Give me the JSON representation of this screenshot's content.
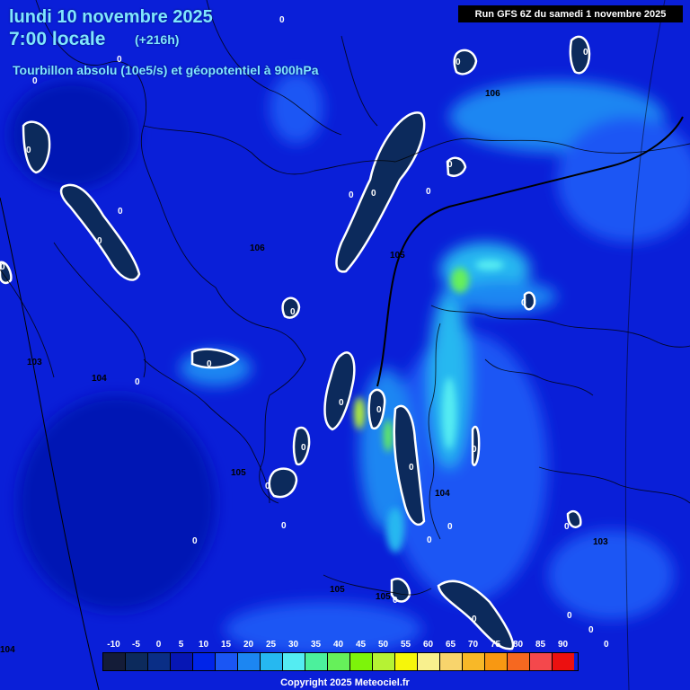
{
  "header": {
    "date": "lundi 10 novembre 2025",
    "time": "7:00 locale",
    "offset": "(+216h)",
    "parameter": "Tourbillon absolu (10e5/s) et géopotentiel à 900hPa",
    "run": "Run GFS 6Z du samedi 1 novembre 2025"
  },
  "map": {
    "geopotential_labels": [
      "106",
      "106",
      "105",
      "103",
      "104",
      "105",
      "104",
      "103",
      "105",
      "105",
      "104"
    ],
    "vorticity_zero_label": "0"
  },
  "legend": {
    "labels": [
      "-10",
      "-5",
      "0",
      "5",
      "10",
      "15",
      "20",
      "25",
      "30",
      "35",
      "40",
      "45",
      "50",
      "55",
      "60",
      "65",
      "70",
      "75",
      "80",
      "85",
      "90"
    ],
    "colors": [
      "#141c38",
      "#0c2a5c",
      "#0a2e86",
      "#0616b4",
      "#0024e8",
      "#1a56f4",
      "#1c86f2",
      "#26b8f0",
      "#54ecf2",
      "#4cf09c",
      "#66f05a",
      "#7df40a",
      "#b6f234",
      "#f6f60a",
      "#f8f08e",
      "#f8d46c",
      "#f8b828",
      "#f89812",
      "#f66820",
      "#f4484c",
      "#ec1010"
    ]
  },
  "footer": {
    "copyright": "Copyright 2025 Meteociel.fr"
  }
}
